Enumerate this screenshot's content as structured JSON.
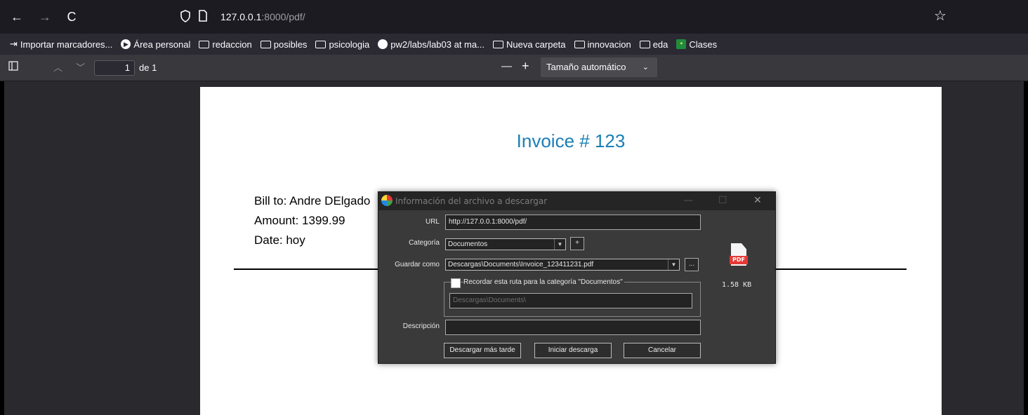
{
  "browser": {
    "nav": {
      "back": "←",
      "forward": "→",
      "reload": "C"
    },
    "url": {
      "host": "127.0.0.1",
      "rest": ":8000/pdf/"
    },
    "bookmarks": [
      {
        "label": "Importar marcadores...",
        "icon": "import-icon"
      },
      {
        "label": "Área personal",
        "icon": "dot-icon"
      },
      {
        "label": "redaccion",
        "icon": "folder-icon"
      },
      {
        "label": "posibles",
        "icon": "folder-icon"
      },
      {
        "label": "psicologia",
        "icon": "folder-icon"
      },
      {
        "label": "pw2/labs/lab03 at ma...",
        "icon": "github-icon"
      },
      {
        "label": "Nueva carpeta",
        "icon": "folder-icon"
      },
      {
        "label": "innovacion",
        "icon": "folder-icon"
      },
      {
        "label": "eda",
        "icon": "folder-icon"
      },
      {
        "label": "Clases",
        "icon": "classroom-icon"
      }
    ]
  },
  "pdf_toolbar": {
    "page_current": "1",
    "page_total": "de 1",
    "zoom_minus": "—",
    "zoom_plus": "+",
    "zoom_value": "Tamaño automático"
  },
  "document": {
    "title": "Invoice # 123",
    "bill_to": "Bill to: Andre DElgado",
    "amount": "Amount: 1399.99",
    "date": "Date: hoy"
  },
  "dialog": {
    "title": "Información del archivo a descargar",
    "url_label": "URL",
    "url_value": "http://127.0.0.1:8000/pdf/",
    "category_label": "Categoría",
    "category_value": "Documentos",
    "add_category": "+",
    "save_as_label": "Guardar como",
    "save_as_value": "Descargas\\Documents\\Invoice_123411231.pdf",
    "browse": "...",
    "remember_label": "Recordar esta ruta para la categoría \"Documentos\"",
    "remember_path": "Descargas\\Documents\\",
    "description_label": "Descripción",
    "description_value": "",
    "file_size": "1.58  KB",
    "file_type": "PDF",
    "buttons": {
      "later": "Descargar más tarde",
      "start": "Iniciar descarga",
      "cancel": "Cancelar"
    },
    "controls": {
      "minimize": "—",
      "maximize": "☐",
      "close": "✕"
    }
  }
}
